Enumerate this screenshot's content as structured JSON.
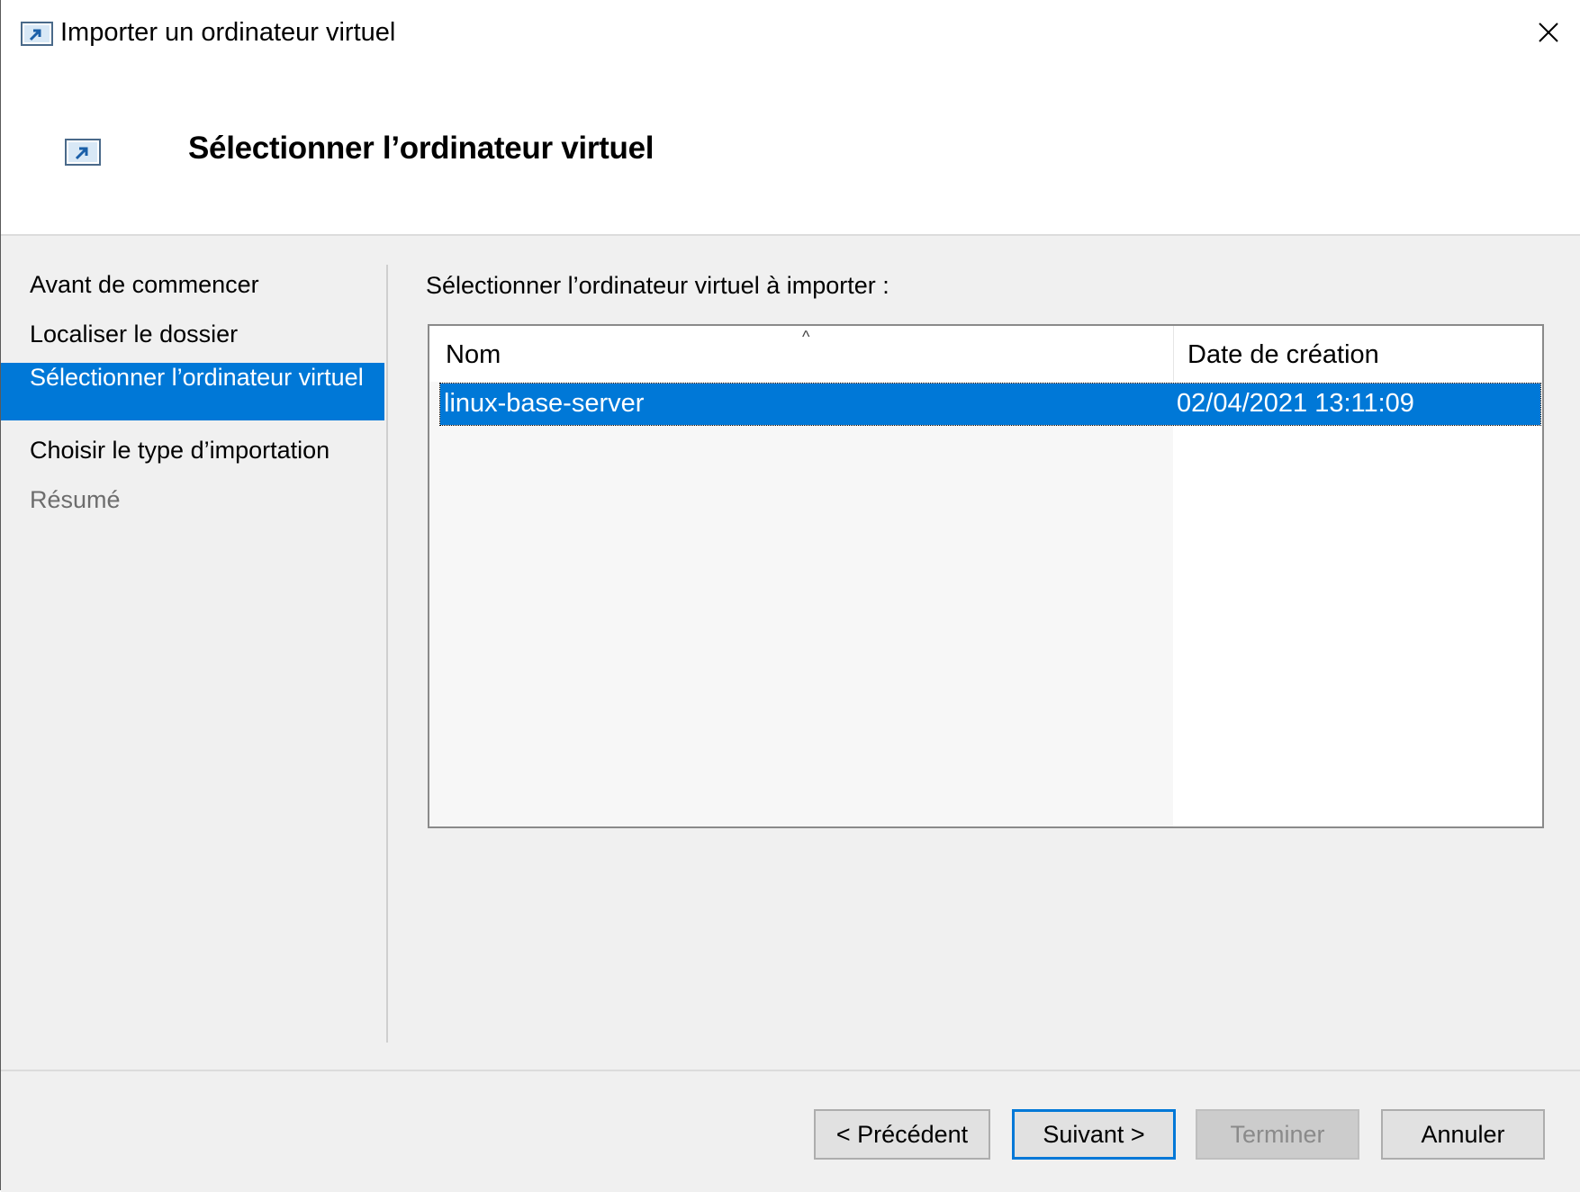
{
  "window": {
    "title": "Importer un ordinateur virtuel"
  },
  "header": {
    "title": "Sélectionner l’ordinateur virtuel"
  },
  "nav": {
    "items": [
      {
        "label": "Avant de commencer",
        "state": "normal"
      },
      {
        "label": "Localiser le dossier",
        "state": "normal"
      },
      {
        "label": "Sélectionner l’ordinateur virtuel",
        "state": "active"
      },
      {
        "label": "Choisir le type d’importation",
        "state": "normal"
      },
      {
        "label": "Résumé",
        "state": "disabled"
      }
    ]
  },
  "main": {
    "label": "Sélectionner l’ordinateur virtuel à importer :",
    "list": {
      "columns": [
        "Nom",
        "Date de création"
      ],
      "sort_indicator": "^",
      "rows": [
        {
          "name": "linux-base-server",
          "date": "02/04/2021 13:11:09",
          "selected": true
        }
      ]
    }
  },
  "footer": {
    "prev_label": "< Précédent",
    "next_label": "Suivant >",
    "finish_label": "Terminer",
    "cancel_label": "Annuler"
  },
  "colors": {
    "accent": "#0078d7",
    "panel": "#f0f0f0"
  }
}
